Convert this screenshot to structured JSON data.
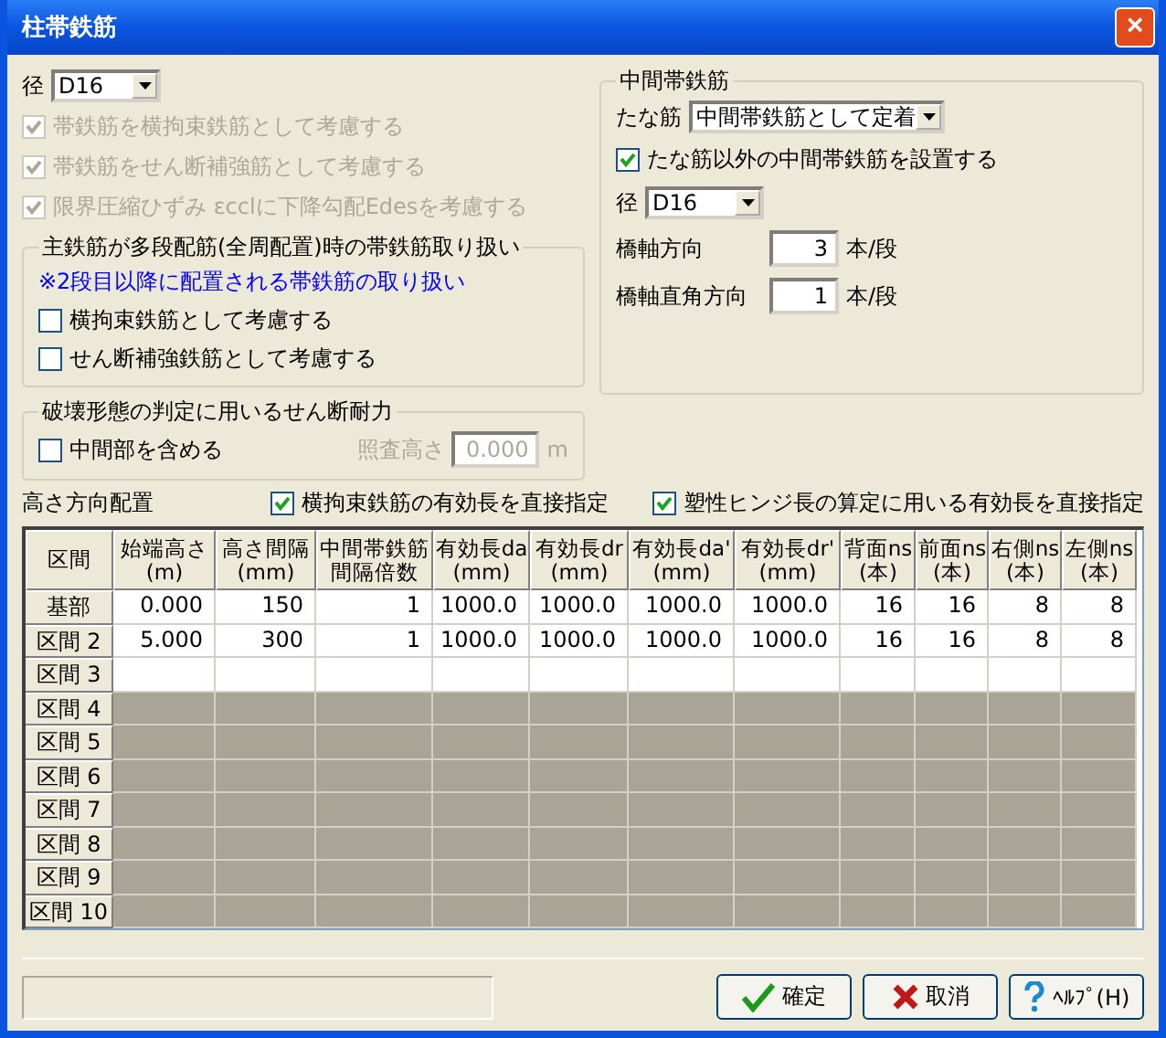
{
  "window": {
    "title": "柱帯鉄筋",
    "close": "×"
  },
  "diameter": {
    "label": "径",
    "value": "D16"
  },
  "options": [
    {
      "label": "帯鉄筋を横拘束鉄筋として考慮する",
      "checked": true,
      "disabled": true
    },
    {
      "label": "帯鉄筋をせん断補強筋として考慮する",
      "checked": true,
      "disabled": true
    },
    {
      "label": "限界圧縮ひずみ εcclに下降勾配Edesを考慮する",
      "checked": true,
      "disabled": true
    }
  ],
  "multi_group": {
    "title": "主鉄筋が多段配筋(全周配置)時の帯鉄筋取り扱い",
    "note": "※2段目以降に配置される帯鉄筋の取り扱い",
    "options": [
      {
        "label": "横拘束鉄筋として考慮する",
        "checked": false,
        "disabled": false
      },
      {
        "label": "せん断補強鉄筋として考慮する",
        "checked": false,
        "disabled": false
      }
    ]
  },
  "shear_group": {
    "title": "破壊形態の判定に用いるせん断耐力",
    "option": {
      "label": "中間部を含める",
      "checked": false,
      "disabled": false
    },
    "height_label": "照査高さ",
    "height_value": "0.000",
    "height_unit": "m",
    "height_disabled": true
  },
  "mid_group": {
    "title": "中間帯鉄筋",
    "shelf_label": "たな筋",
    "shelf_value": "中間帯鉄筋として定着",
    "option": {
      "label": "たな筋以外の中間帯鉄筋を設置する",
      "checked": true,
      "disabled": false
    },
    "diameter_label": "径",
    "diameter_value": "D16",
    "counts": [
      {
        "label": "橋軸方向",
        "value": "3",
        "unit": "本/段"
      },
      {
        "label": "橋軸直角方向",
        "value": "1",
        "unit": "本/段"
      }
    ]
  },
  "table_title": "高さ方向配置",
  "table_options": [
    {
      "label": "横拘束鉄筋の有効長を直接指定",
      "checked": true,
      "disabled": false
    },
    {
      "label": "塑性ヒンジ長の算定に用いる有効長を直接指定",
      "checked": true,
      "disabled": false
    }
  ],
  "table": {
    "columns": [
      [
        "区間"
      ],
      [
        "始端高さ",
        "(m)"
      ],
      [
        "高さ間隔",
        "(mm)"
      ],
      [
        "中間帯鉄筋",
        "間隔倍数"
      ],
      [
        "有効長da",
        "(mm)"
      ],
      [
        "有効長dr",
        "(mm)"
      ],
      [
        "有効長da'",
        "(mm)"
      ],
      [
        "有効長dr'",
        "(mm)"
      ],
      [
        "背面ns",
        "(本)"
      ],
      [
        "前面ns",
        "(本)"
      ],
      [
        "右側ns",
        "(本)"
      ],
      [
        "左側ns",
        "(本)"
      ]
    ],
    "rows": [
      {
        "label": "基部",
        "disabled": false,
        "cells": [
          "0.000",
          "150",
          "1",
          "1000.0",
          "1000.0",
          "1000.0",
          "1000.0",
          "16",
          "16",
          "8",
          "8"
        ]
      },
      {
        "label": "区間 2",
        "disabled": false,
        "cells": [
          "5.000",
          "300",
          "1",
          "1000.0",
          "1000.0",
          "1000.0",
          "1000.0",
          "16",
          "16",
          "8",
          "8"
        ]
      },
      {
        "label": "区間 3",
        "disabled": false
      },
      {
        "label": "区間 4",
        "disabled": true
      },
      {
        "label": "区間 5",
        "disabled": true
      },
      {
        "label": "区間 6",
        "disabled": true
      },
      {
        "label": "区間 7",
        "disabled": true
      },
      {
        "label": "区間 8",
        "disabled": true
      },
      {
        "label": "区間 9",
        "disabled": true
      },
      {
        "label": "区間 10",
        "disabled": true
      }
    ]
  },
  "buttons": [
    {
      "kind": "ok",
      "label": "確定"
    },
    {
      "kind": "cancel",
      "label": "取消"
    },
    {
      "kind": "help",
      "label": "ﾍﾙﾌﾟ(H)"
    }
  ]
}
